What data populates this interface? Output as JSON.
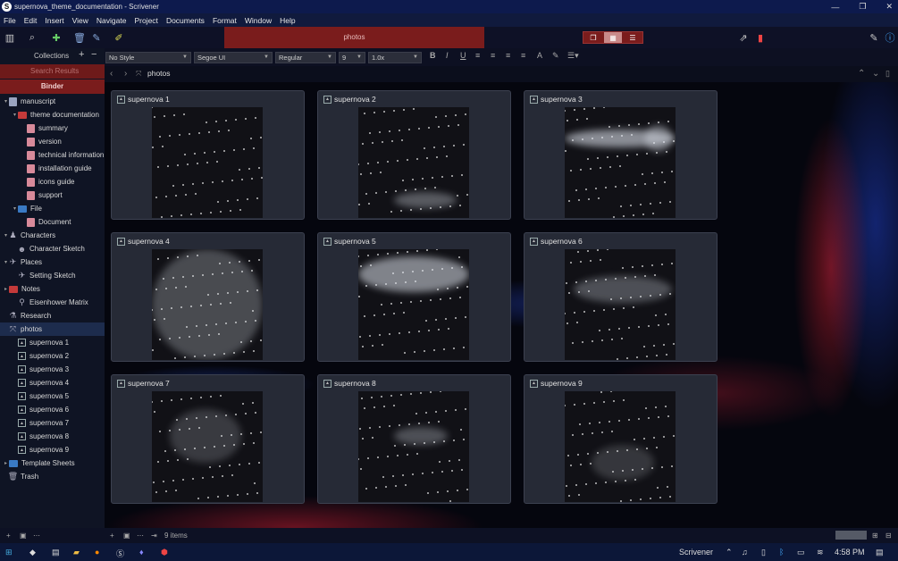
{
  "window": {
    "title": "supernova_theme_documentation - Scrivener",
    "app_letter": "S",
    "controls": [
      "—",
      "❐",
      "✕"
    ]
  },
  "menu": [
    "File",
    "Edit",
    "Insert",
    "View",
    "Navigate",
    "Project",
    "Documents",
    "Format",
    "Window",
    "Help"
  ],
  "toolbar": {
    "banner": "photos"
  },
  "sidebar": {
    "collections_label": "Collections",
    "search_results_label": "Search Results",
    "binder_label": "Binder",
    "items": [
      {
        "label": "manuscript",
        "icon": "manuscript-icon",
        "depth": 0,
        "expander": "▾"
      },
      {
        "label": "theme documentation",
        "icon": "folder-icon",
        "depth": 1,
        "expander": "▾"
      },
      {
        "label": "summary",
        "icon": "document-icon",
        "depth": 2
      },
      {
        "label": "version",
        "icon": "document-icon",
        "depth": 2
      },
      {
        "label": "technical information",
        "icon": "document-icon",
        "depth": 2
      },
      {
        "label": "installation guide",
        "icon": "document-icon",
        "depth": 2
      },
      {
        "label": "icons guide",
        "icon": "document-icon",
        "depth": 2
      },
      {
        "label": "support",
        "icon": "document-icon",
        "depth": 2
      },
      {
        "label": "File",
        "icon": "folder-blue-icon",
        "depth": 1,
        "expander": "▾"
      },
      {
        "label": "Document",
        "icon": "document-icon",
        "depth": 2
      },
      {
        "label": "Characters",
        "icon": "character-icon",
        "depth": 0,
        "expander": "▾"
      },
      {
        "label": "Character Sketch",
        "icon": "character-sketch-icon",
        "depth": 1
      },
      {
        "label": "Places",
        "icon": "places-icon",
        "depth": 0,
        "expander": "▾"
      },
      {
        "label": "Setting Sketch",
        "icon": "setting-sketch-icon",
        "depth": 1
      },
      {
        "label": "Notes",
        "icon": "notes-icon",
        "depth": 0,
        "expander": "▸"
      },
      {
        "label": "Eisenhower Matrix",
        "icon": "matrix-icon",
        "depth": 1
      },
      {
        "label": "Research",
        "icon": "research-icon",
        "depth": 0
      },
      {
        "label": "photos",
        "icon": "photo-folder-icon",
        "depth": 0,
        "selected": true
      },
      {
        "label": "supernova 1",
        "icon": "photo-icon",
        "depth": 1
      },
      {
        "label": "supernova 2",
        "icon": "photo-icon",
        "depth": 1
      },
      {
        "label": "supernova 3",
        "icon": "photo-icon",
        "depth": 1
      },
      {
        "label": "supernova 4",
        "icon": "photo-icon",
        "depth": 1
      },
      {
        "label": "supernova 5",
        "icon": "photo-icon",
        "depth": 1
      },
      {
        "label": "supernova 6",
        "icon": "photo-icon",
        "depth": 1
      },
      {
        "label": "supernova 7",
        "icon": "photo-icon",
        "depth": 1
      },
      {
        "label": "supernova 8",
        "icon": "photo-icon",
        "depth": 1
      },
      {
        "label": "supernova 9",
        "icon": "photo-icon",
        "depth": 1
      },
      {
        "label": "Template Sheets",
        "icon": "template-icon",
        "depth": 0,
        "expander": "▸"
      },
      {
        "label": "Trash",
        "icon": "trash-icon",
        "depth": 0
      }
    ]
  },
  "format": {
    "style": "No Style",
    "font": "Segoe UI",
    "weight": "Regular",
    "size": "9",
    "spacing": "1.0x"
  },
  "nav": {
    "path": "photos"
  },
  "cards": [
    "supernova 1",
    "supernova 2",
    "supernova 3",
    "supernova 4",
    "supernova 5",
    "supernova 6",
    "supernova 7",
    "supernova 8",
    "supernova 9"
  ],
  "status": {
    "count": "9 items"
  },
  "taskbar": {
    "app": "Scrivener",
    "time": "4:58 PM"
  },
  "colors": {
    "accent": "#7a1c1c",
    "titlebar": "#0d1a4d",
    "card": "#262a36"
  }
}
